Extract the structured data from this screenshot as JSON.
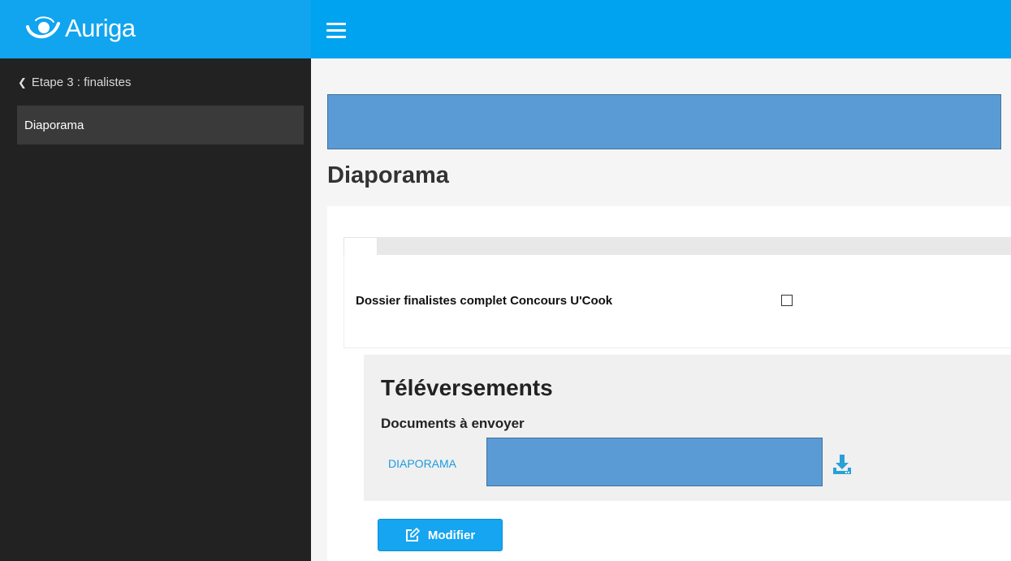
{
  "app": {
    "name": "Auriga"
  },
  "topbar": {
    "menu_icon": "hamburger-icon",
    "color": "#00a3f0"
  },
  "sidebar": {
    "back_label": "Etape 3 : finalistes",
    "back_icon": "chevron-left-icon",
    "items": [
      {
        "label": "Diaporama",
        "active": true
      }
    ]
  },
  "main": {
    "page_title": "Diaporama",
    "form": {
      "checkbox_label": "Dossier finalistes complet Concours U'Cook",
      "checkbox_checked": false
    },
    "uploads": {
      "title": "Téléversements",
      "subtitle": "Documents à envoyer",
      "documents": [
        {
          "label": "DIAPORAMA",
          "icon": "download-icon"
        }
      ]
    },
    "modify_button": {
      "label": "Modifier",
      "icon": "edit-icon"
    }
  },
  "colors": {
    "accent": "#16a5f0",
    "sidebar_bg": "#222222",
    "redaction": "#5b9bd5"
  }
}
